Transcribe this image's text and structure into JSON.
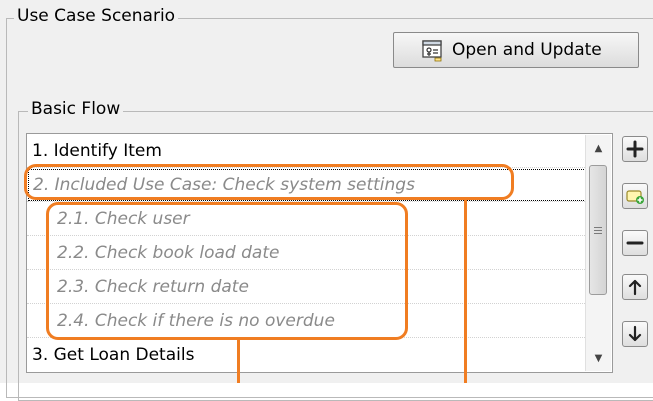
{
  "scenario_group": {
    "title": "Use Case Scenario",
    "open_update_label": "Open and Update"
  },
  "basic_flow": {
    "title": "Basic Flow",
    "items": [
      {
        "label": "1. Identify Item"
      },
      {
        "label": "2. Included Use Case: Check system settings"
      },
      {
        "label": "2.1. Check user"
      },
      {
        "label": "2.2. Check book load date"
      },
      {
        "label": "2.3. Check return date"
      },
      {
        "label": "2.4. Check if there is no overdue"
      },
      {
        "label": "3. Get Loan Details"
      }
    ]
  },
  "side_buttons": {
    "icons": [
      "plus-icon",
      "add-included-icon",
      "minus-icon",
      "arrow-up-icon",
      "arrow-down-icon"
    ]
  },
  "colors": {
    "callout": "#f07d22",
    "included_text": "#8a8a8a"
  }
}
